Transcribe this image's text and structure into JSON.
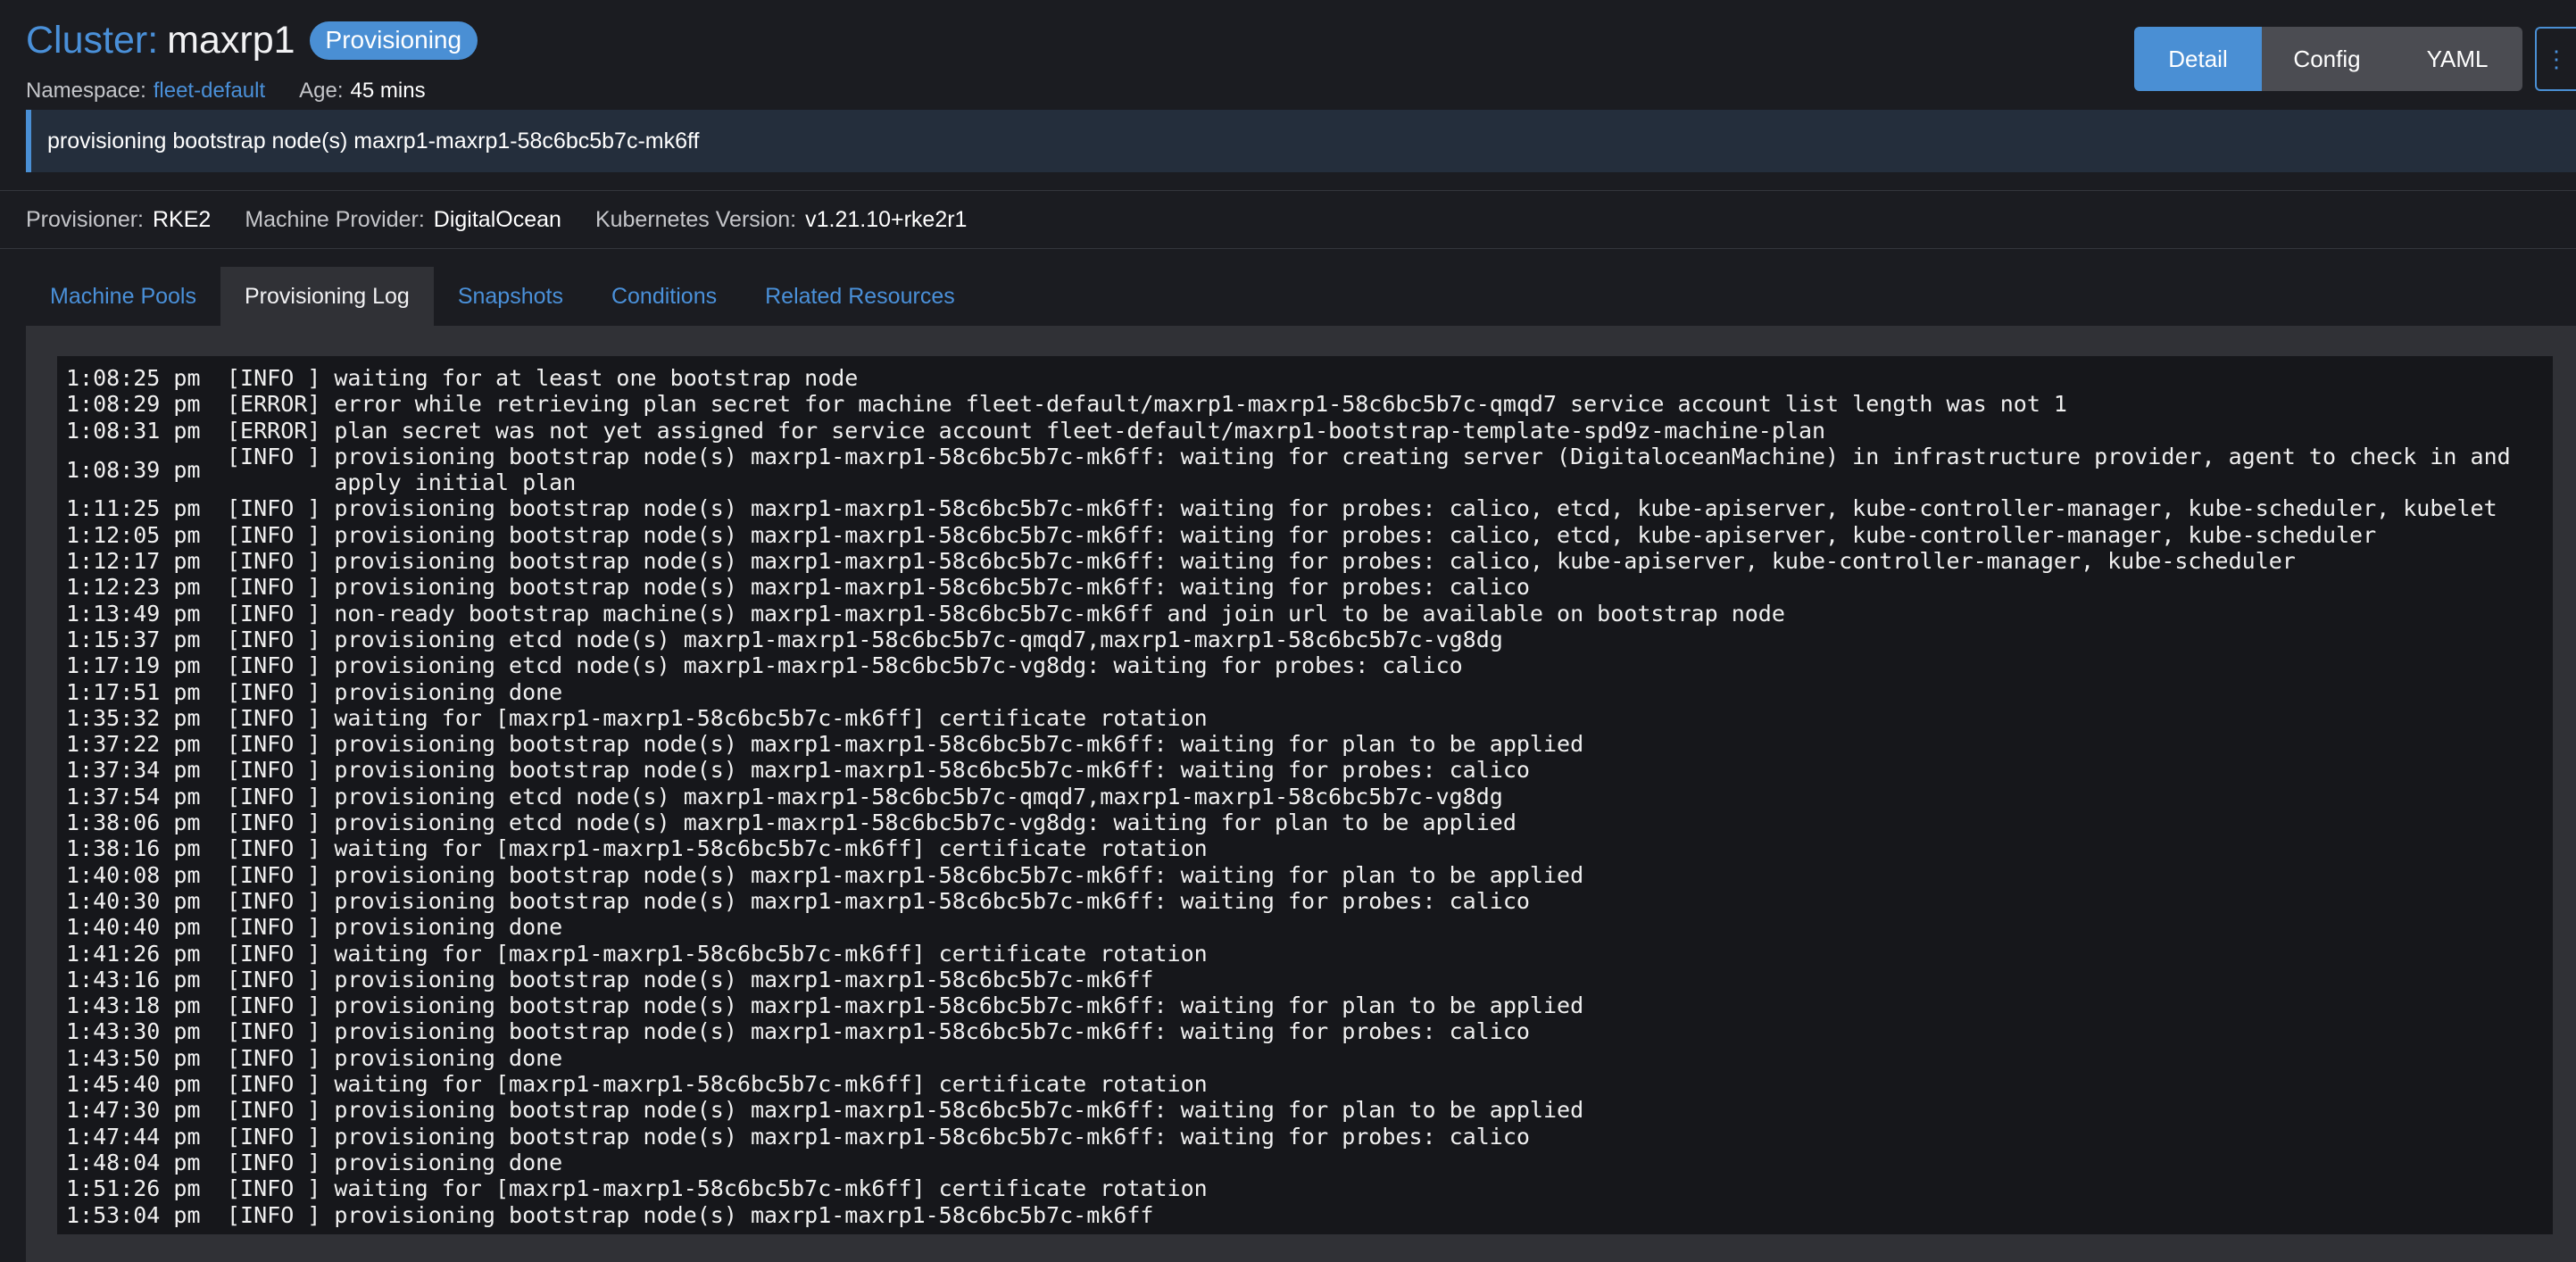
{
  "header": {
    "title_prefix": "Cluster:",
    "cluster_name": "maxrp1",
    "status_badge": "Provisioning",
    "namespace_label": "Namespace:",
    "namespace_value": "fleet-default",
    "age_label": "Age:",
    "age_value": "45 mins"
  },
  "view_toggle": {
    "detail": "Detail",
    "config": "Config",
    "yaml": "YAML",
    "more": "⋮"
  },
  "banner": {
    "message": "provisioning bootstrap node(s) maxrp1-maxrp1-58c6bc5b7c-mk6ff"
  },
  "info": {
    "provisioner_label": "Provisioner:",
    "provisioner_value": "RKE2",
    "machine_provider_label": "Machine Provider:",
    "machine_provider_value": "DigitalOcean",
    "k8s_version_label": "Kubernetes Version:",
    "k8s_version_value": "v1.21.10+rke2r1"
  },
  "tabs": [
    {
      "label": "Machine Pools"
    },
    {
      "label": "Provisioning Log"
    },
    {
      "label": "Snapshots"
    },
    {
      "label": "Conditions"
    },
    {
      "label": "Related Resources"
    }
  ],
  "active_tab": "Provisioning Log",
  "colors": {
    "accent": "#4a8fd4",
    "background": "#1b1c21",
    "log_background": "#16171b"
  },
  "log": [
    {
      "time": "1:08:25 pm",
      "level": "[INFO ]",
      "message": "waiting for at least one bootstrap node"
    },
    {
      "time": "1:08:29 pm",
      "level": "[ERROR]",
      "message": "error while retrieving plan secret for machine fleet-default/maxrp1-maxrp1-58c6bc5b7c-qmqd7 service account list length was not 1"
    },
    {
      "time": "1:08:31 pm",
      "level": "[ERROR]",
      "message": "plan secret was not yet assigned for service account fleet-default/maxrp1-bootstrap-template-spd9z-machine-plan"
    },
    {
      "time": "1:08:39 pm",
      "level": "[INFO ]",
      "message": "provisioning bootstrap node(s) maxrp1-maxrp1-58c6bc5b7c-mk6ff: waiting for creating server (DigitaloceanMachine) in infrastructure provider, agent to check in and apply initial plan"
    },
    {
      "time": "1:11:25 pm",
      "level": "[INFO ]",
      "message": "provisioning bootstrap node(s) maxrp1-maxrp1-58c6bc5b7c-mk6ff: waiting for probes: calico, etcd, kube-apiserver, kube-controller-manager, kube-scheduler, kubelet"
    },
    {
      "time": "1:12:05 pm",
      "level": "[INFO ]",
      "message": "provisioning bootstrap node(s) maxrp1-maxrp1-58c6bc5b7c-mk6ff: waiting for probes: calico, etcd, kube-apiserver, kube-controller-manager, kube-scheduler"
    },
    {
      "time": "1:12:17 pm",
      "level": "[INFO ]",
      "message": "provisioning bootstrap node(s) maxrp1-maxrp1-58c6bc5b7c-mk6ff: waiting for probes: calico, kube-apiserver, kube-controller-manager, kube-scheduler"
    },
    {
      "time": "1:12:23 pm",
      "level": "[INFO ]",
      "message": "provisioning bootstrap node(s) maxrp1-maxrp1-58c6bc5b7c-mk6ff: waiting for probes: calico"
    },
    {
      "time": "1:13:49 pm",
      "level": "[INFO ]",
      "message": "non-ready bootstrap machine(s) maxrp1-maxrp1-58c6bc5b7c-mk6ff and join url to be available on bootstrap node"
    },
    {
      "time": "1:15:37 pm",
      "level": "[INFO ]",
      "message": "provisioning etcd node(s) maxrp1-maxrp1-58c6bc5b7c-qmqd7,maxrp1-maxrp1-58c6bc5b7c-vg8dg"
    },
    {
      "time": "1:17:19 pm",
      "level": "[INFO ]",
      "message": "provisioning etcd node(s) maxrp1-maxrp1-58c6bc5b7c-vg8dg: waiting for probes: calico"
    },
    {
      "time": "1:17:51 pm",
      "level": "[INFO ]",
      "message": "provisioning done"
    },
    {
      "time": "1:35:32 pm",
      "level": "[INFO ]",
      "message": "waiting for [maxrp1-maxrp1-58c6bc5b7c-mk6ff] certificate rotation"
    },
    {
      "time": "1:37:22 pm",
      "level": "[INFO ]",
      "message": "provisioning bootstrap node(s) maxrp1-maxrp1-58c6bc5b7c-mk6ff: waiting for plan to be applied"
    },
    {
      "time": "1:37:34 pm",
      "level": "[INFO ]",
      "message": "provisioning bootstrap node(s) maxrp1-maxrp1-58c6bc5b7c-mk6ff: waiting for probes: calico"
    },
    {
      "time": "1:37:54 pm",
      "level": "[INFO ]",
      "message": "provisioning etcd node(s) maxrp1-maxrp1-58c6bc5b7c-qmqd7,maxrp1-maxrp1-58c6bc5b7c-vg8dg"
    },
    {
      "time": "1:38:06 pm",
      "level": "[INFO ]",
      "message": "provisioning etcd node(s) maxrp1-maxrp1-58c6bc5b7c-vg8dg: waiting for plan to be applied"
    },
    {
      "time": "1:38:16 pm",
      "level": "[INFO ]",
      "message": "waiting for [maxrp1-maxrp1-58c6bc5b7c-mk6ff] certificate rotation"
    },
    {
      "time": "1:40:08 pm",
      "level": "[INFO ]",
      "message": "provisioning bootstrap node(s) maxrp1-maxrp1-58c6bc5b7c-mk6ff: waiting for plan to be applied"
    },
    {
      "time": "1:40:30 pm",
      "level": "[INFO ]",
      "message": "provisioning bootstrap node(s) maxrp1-maxrp1-58c6bc5b7c-mk6ff: waiting for probes: calico"
    },
    {
      "time": "1:40:40 pm",
      "level": "[INFO ]",
      "message": "provisioning done"
    },
    {
      "time": "1:41:26 pm",
      "level": "[INFO ]",
      "message": "waiting for [maxrp1-maxrp1-58c6bc5b7c-mk6ff] certificate rotation"
    },
    {
      "time": "1:43:16 pm",
      "level": "[INFO ]",
      "message": "provisioning bootstrap node(s) maxrp1-maxrp1-58c6bc5b7c-mk6ff"
    },
    {
      "time": "1:43:18 pm",
      "level": "[INFO ]",
      "message": "provisioning bootstrap node(s) maxrp1-maxrp1-58c6bc5b7c-mk6ff: waiting for plan to be applied"
    },
    {
      "time": "1:43:30 pm",
      "level": "[INFO ]",
      "message": "provisioning bootstrap node(s) maxrp1-maxrp1-58c6bc5b7c-mk6ff: waiting for probes: calico"
    },
    {
      "time": "1:43:50 pm",
      "level": "[INFO ]",
      "message": "provisioning done"
    },
    {
      "time": "1:45:40 pm",
      "level": "[INFO ]",
      "message": "waiting for [maxrp1-maxrp1-58c6bc5b7c-mk6ff] certificate rotation"
    },
    {
      "time": "1:47:30 pm",
      "level": "[INFO ]",
      "message": "provisioning bootstrap node(s) maxrp1-maxrp1-58c6bc5b7c-mk6ff: waiting for plan to be applied"
    },
    {
      "time": "1:47:44 pm",
      "level": "[INFO ]",
      "message": "provisioning bootstrap node(s) maxrp1-maxrp1-58c6bc5b7c-mk6ff: waiting for probes: calico"
    },
    {
      "time": "1:48:04 pm",
      "level": "[INFO ]",
      "message": "provisioning done"
    },
    {
      "time": "1:51:26 pm",
      "level": "[INFO ]",
      "message": "waiting for [maxrp1-maxrp1-58c6bc5b7c-mk6ff] certificate rotation"
    },
    {
      "time": "1:53:04 pm",
      "level": "[INFO ]",
      "message": "provisioning bootstrap node(s) maxrp1-maxrp1-58c6bc5b7c-mk6ff"
    }
  ]
}
